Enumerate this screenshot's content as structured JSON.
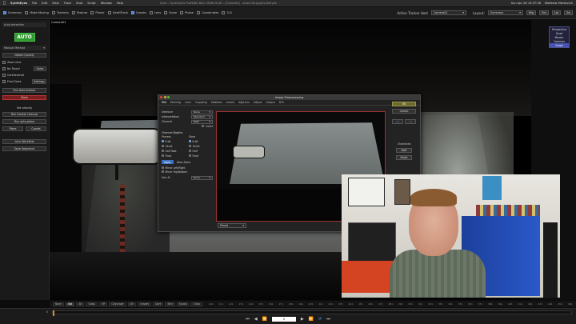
{
  "menubar": {
    "app": "SynthEyes",
    "items": [
      "File",
      "Edit",
      "View",
      "Track",
      "Shot",
      "Script",
      "Window",
      "Help"
    ],
    "window_title": "Scen - SynthEyes Pro/W64 BLD 1908.04.4H - [Comwell] - dual.030.jpg/SynthEyes",
    "clock": "Sun Apr 28 10:37:36",
    "user": "Matthew Merkovich"
  },
  "toolbar": {
    "checks": [
      {
        "label": "Summary",
        "on": true
      },
      {
        "label": "Make Moving",
        "on": false
      },
      {
        "label": "Trackers",
        "on": false
      },
      {
        "label": "Feature",
        "on": false
      },
      {
        "label": "Planar",
        "on": false
      },
      {
        "label": "GeoHTrack",
        "on": false
      },
      {
        "label": "Graphs",
        "on": true
      },
      {
        "label": "Lens",
        "on": false
      },
      {
        "label": "Solve",
        "on": false
      },
      {
        "label": "Phase",
        "on": false
      },
      {
        "label": "Coordinates",
        "on": false
      },
      {
        "label": "3-D",
        "on": false
      }
    ],
    "active_tracker_label": "Active Tracker Host",
    "active_tracker_value": "Camera01",
    "layout_label": "Layout:",
    "layout_value": "Summary",
    "right_buttons": [
      "Mrg",
      "Em",
      "Lat",
      "Sw"
    ]
  },
  "leftpanel": {
    "header": "Auto-detection",
    "auto_label": "AUTO",
    "section": "Manual Method",
    "buttons": [
      "Detect Quickly",
      "Run Auto-tracker",
      "Run tracker cleanup",
      "Run auto-plane"
    ],
    "rows": [
      {
        "label": "Zoom lens",
        "action": ""
      },
      {
        "label": "No Tripod",
        "action": "Solve"
      },
      {
        "label": "Cantilevered",
        "action": ""
      },
      {
        "label": "Final Solve",
        "action": "Settings"
      }
    ],
    "mask_btn": "Mask",
    "set_velocity": "Set velocity",
    "place_btn": "Place",
    "coords_btn": "Coords",
    "lens_workflow": "Lens Workflow",
    "save_sequence": "Save Sequence"
  },
  "viewer": {
    "label": "Camera01"
  },
  "dialog": {
    "title": "Image Preprocessing",
    "tabs": [
      "Mid",
      "Filtering",
      "Lens",
      "Cropping",
      "Stabilize",
      "Levels",
      "Adj/Lens",
      "Adjust",
      "Output",
      "ROI"
    ],
    "fields": [
      {
        "label": "Interlace",
        "value": "None"
      },
      {
        "label": "Interpretation",
        "value": "Standard"
      },
      {
        "label": "Channel",
        "value": "RGB"
      }
    ],
    "invert": "Invert",
    "section": "Channel Depths",
    "col_process": "Process",
    "col_store": "Store",
    "process_opts": [
      "8-bit",
      "16-bit",
      "Half float",
      "Float"
    ],
    "store_opts": [
      "8-bit",
      "16-bit",
      "Half",
      "Float"
    ],
    "apply_btn": "Apply",
    "keep_alpha": "Keep Alpha",
    "mirror_lr": "Mirror Left/Right",
    "mirror_tb": "Mirror Top/Bottom",
    "rotate_label": "Gen Al",
    "rotate_value": "None",
    "bottom_select": "Mixed",
    "ok": "OK",
    "cancel": "Cancel",
    "checklines": "Checklines",
    "split": "Split",
    "reset": "Reset"
  },
  "rightpanel": {
    "menu": [
      "Perspective",
      "Quad",
      "Mosaic",
      "Cameras",
      "Graph"
    ],
    "selected": "Graph"
  },
  "bottombar": {
    "tabs": [
      "None",
      "Std",
      "Alt",
      "Glass",
      "Off",
      "Cityscape",
      "Dir",
      "Grapes",
      "Dark",
      "Bird",
      "Studio",
      "Cross"
    ],
    "active_tab": "Std",
    "ticks": [
      "101",
      "111",
      "121",
      "131",
      "141",
      "151",
      "161",
      "171",
      "181",
      "191",
      "201",
      "211",
      "221",
      "231",
      "241",
      "251",
      "261",
      "271",
      "281",
      "291",
      "301",
      "311",
      "321",
      "331",
      "341",
      "351",
      "361",
      "371",
      "381",
      "391",
      "401",
      "411",
      "421",
      "431",
      "441",
      "451",
      "461"
    ]
  },
  "transport": {
    "frame": "0",
    "start_label": "0",
    "progress": 0.0
  }
}
